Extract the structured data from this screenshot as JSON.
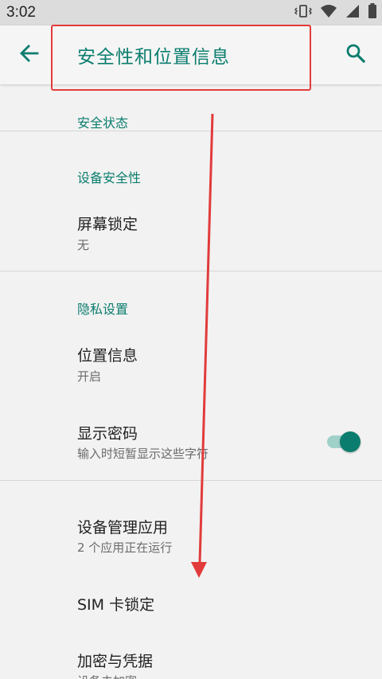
{
  "status_bar": {
    "time": "3:02",
    "icons": [
      "vibrate-icon",
      "wifi-icon",
      "signal-icon",
      "battery-icon"
    ]
  },
  "app_bar": {
    "title": "安全性和位置信息",
    "back_icon": "arrow-left-icon",
    "search_icon": "search-icon"
  },
  "sections": {
    "security_status": {
      "label": "安全状态"
    },
    "device_security": {
      "label": "设备安全性"
    },
    "privacy": {
      "label": "隐私设置"
    }
  },
  "items": {
    "screen_lock": {
      "title": "屏幕锁定",
      "subtitle": "无"
    },
    "location": {
      "title": "位置信息",
      "subtitle": "开启"
    },
    "show_passwords": {
      "title": "显示密码",
      "subtitle": "输入时短暂显示这些字符",
      "enabled": true
    },
    "device_admin": {
      "title": "设备管理应用",
      "subtitle": "2 个应用正在运行"
    },
    "sim_lock": {
      "title": "SIM 卡锁定"
    },
    "encryption": {
      "title": "加密与凭据",
      "subtitle": "设备未加密"
    }
  },
  "colors": {
    "accent": "#0b7d6e",
    "annotation": "#e23b3b"
  }
}
